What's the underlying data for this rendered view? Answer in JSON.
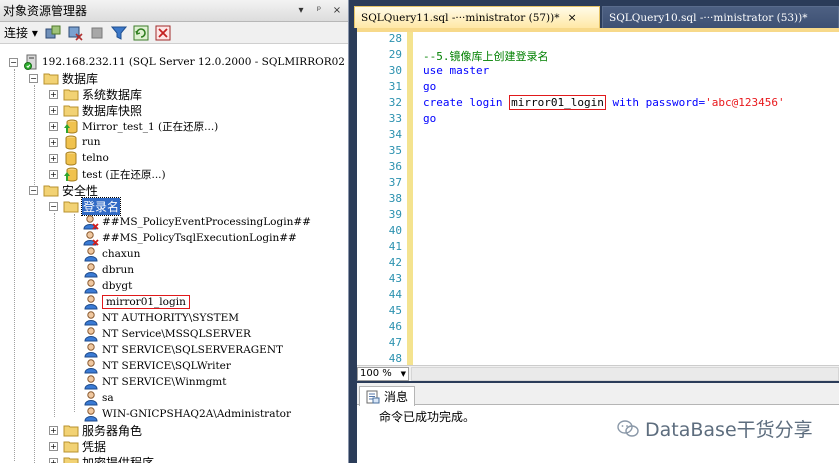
{
  "object_explorer": {
    "title": "对象资源管理器",
    "title_buttons": [
      "▾",
      "ᵖ",
      "×"
    ],
    "toolbar": {
      "connect_label": "连接"
    },
    "tree": [
      {
        "label": "192.168.232.11 (SQL Server 12.0.2000 - SQLMIRROR02",
        "expander": "−",
        "icon": "server-icon"
      },
      {
        "label": "数据库",
        "expander": "−",
        "icon": "folder-icon"
      },
      {
        "label": "系统数据库",
        "expander": "+",
        "icon": "folder-icon"
      },
      {
        "label": "数据库快照",
        "expander": "+",
        "icon": "folder-icon"
      },
      {
        "label": "Mirror_test_1 (正在还原...)",
        "expander": "+",
        "icon": "database-restoring-icon"
      },
      {
        "label": "run",
        "expander": "+",
        "icon": "database-icon"
      },
      {
        "label": "telno",
        "expander": "+",
        "icon": "database-icon"
      },
      {
        "label": "test (正在还原...)",
        "expander": "+",
        "icon": "database-restoring-icon"
      },
      {
        "label": "安全性",
        "expander": "−",
        "icon": "folder-icon"
      },
      {
        "label": "登录名",
        "expander": "−",
        "icon": "folder-icon"
      },
      {
        "label": "##MS_PolicyEventProcessingLogin##",
        "icon": "login-disabled-icon"
      },
      {
        "label": "##MS_PolicyTsqlExecutionLogin##",
        "icon": "login-disabled-icon"
      },
      {
        "label": "chaxun",
        "icon": "login-icon"
      },
      {
        "label": "dbrun",
        "icon": "login-icon"
      },
      {
        "label": "dbygt",
        "icon": "login-icon"
      },
      {
        "label": "mirror01_login",
        "icon": "login-icon"
      },
      {
        "label": "NT AUTHORITY\\SYSTEM",
        "icon": "login-icon"
      },
      {
        "label": "NT Service\\MSSQLSERVER",
        "icon": "login-icon"
      },
      {
        "label": "NT SERVICE\\SQLSERVERAGENT",
        "icon": "login-icon"
      },
      {
        "label": "NT SERVICE\\SQLWriter",
        "icon": "login-icon"
      },
      {
        "label": "NT SERVICE\\Winmgmt",
        "icon": "login-icon"
      },
      {
        "label": "sa",
        "icon": "login-icon"
      },
      {
        "label": "WIN-GNICPSHAQ2A\\Administrator",
        "icon": "login-icon"
      },
      {
        "label": "服务器角色",
        "expander": "+",
        "icon": "folder-icon"
      },
      {
        "label": "凭据",
        "expander": "+",
        "icon": "folder-icon"
      },
      {
        "label": "加密提供程序",
        "expander": "+",
        "icon": "folder-icon"
      }
    ]
  },
  "tabs": [
    {
      "label": "SQLQuery11.sql -···ministrator (57))*",
      "close": "×",
      "active": true
    },
    {
      "label": "SQLQuery10.sql -···ministrator (53))*",
      "active": false
    }
  ],
  "editor": {
    "line_numbers": [
      "28",
      "29",
      "30",
      "31",
      "32",
      "33",
      "34",
      "35",
      "36",
      "37",
      "38",
      "39",
      "40",
      "41",
      "42",
      "43",
      "44",
      "45",
      "46",
      "47",
      "48"
    ],
    "code": {
      "comment": "--5.镜像库上创建登录名",
      "use_kw": "use",
      "use_db": "master",
      "go1": "go",
      "create_kw": "create login",
      "login_name": "mirror01_login",
      "with_kw": "with password=",
      "password": "'abc@123456'",
      "go2": "go"
    }
  },
  "zoom": {
    "value": "100 %"
  },
  "results": {
    "messages_tab": "消息",
    "message": "命令已成功完成。"
  },
  "watermark": {
    "text": "DataBase干货分享"
  },
  "colors": {
    "keyword": "#0000ff",
    "comment": "#008000",
    "string": "#e8181c",
    "line_number": "#2b91af",
    "highlight_box": "#e0191b",
    "selection": "#316ac5"
  }
}
